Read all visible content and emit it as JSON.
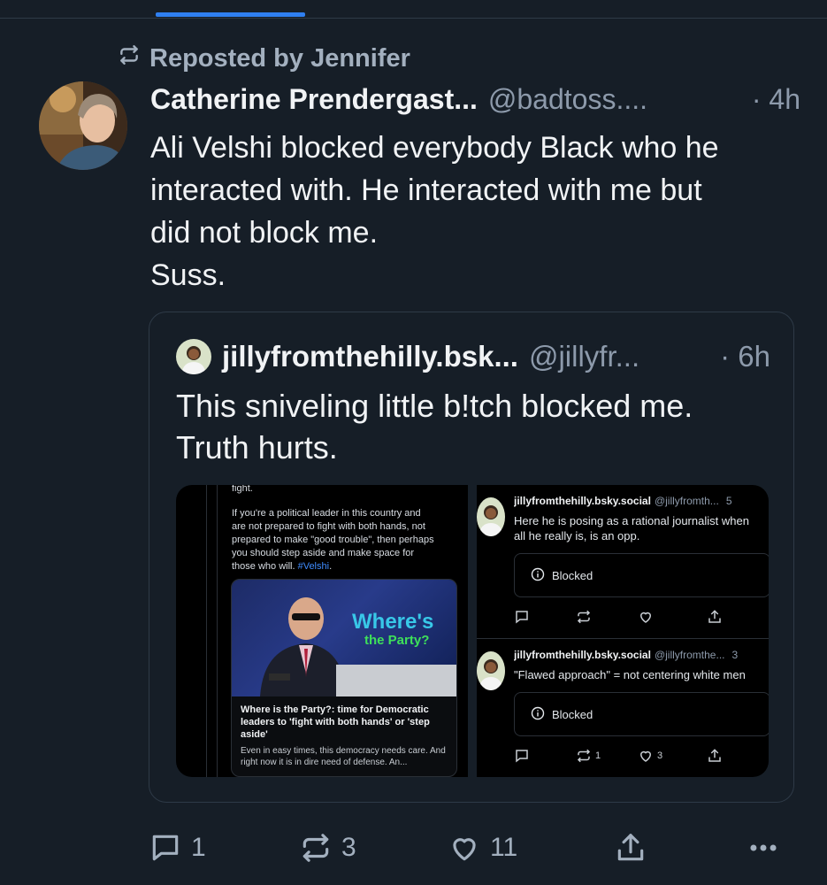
{
  "repost": {
    "label": "Reposted by Jennifer"
  },
  "post": {
    "author_name": "Catherine Prendergast...",
    "author_handle": "@badtoss....",
    "time": "· 4h",
    "text": "Ali Velshi blocked everybody Black who he\ninteracted with. He interacted with me but\ndid not block me.\nSuss."
  },
  "quote": {
    "author_name": "jillyfromthehilly.bsk...",
    "author_handle": "@jillyfr...",
    "time": "· 6h",
    "text": "This sniveling little b!tch blocked me.\nTruth hurts.",
    "left_image": {
      "text_top": "fight.",
      "paragraph": "If you're a political leader in this country and\nare not prepared to fight with both hands, not\nprepared to make \"good trouble\", then perhaps\nyou should step aside and make space for\nthose who will. ",
      "hashtag": "#Velshi",
      "headline_art_1": "Where's",
      "headline_art_2": "the Party?",
      "card_title": "Where is the Party?: time for Democratic leaders to 'fight with both hands' or 'step aside'",
      "card_desc": "Even in easy times, this democracy needs care. And right now it is in dire need of defense. An..."
    },
    "right_image": {
      "item1": {
        "name": "jillyfromthehilly.bsky.social",
        "handle": "@jillyfromth...",
        "time": "5",
        "body": "Here he is posing as a rational journalist when\nall he really is, is an opp.",
        "blocked": "Blocked"
      },
      "item2": {
        "name": "jillyfromthehilly.bsky.social",
        "handle": "@jillyfromthe...",
        "time": "3",
        "body": "\"Flawed approach\" = not centering white men",
        "blocked": "Blocked",
        "reposts": "1",
        "likes": "3"
      }
    }
  },
  "actions": {
    "replies": "1",
    "reposts": "3",
    "likes": "11"
  },
  "colors": {
    "background": "#161e27",
    "accent": "#2f7ff0",
    "muted": "#8d9aab"
  }
}
